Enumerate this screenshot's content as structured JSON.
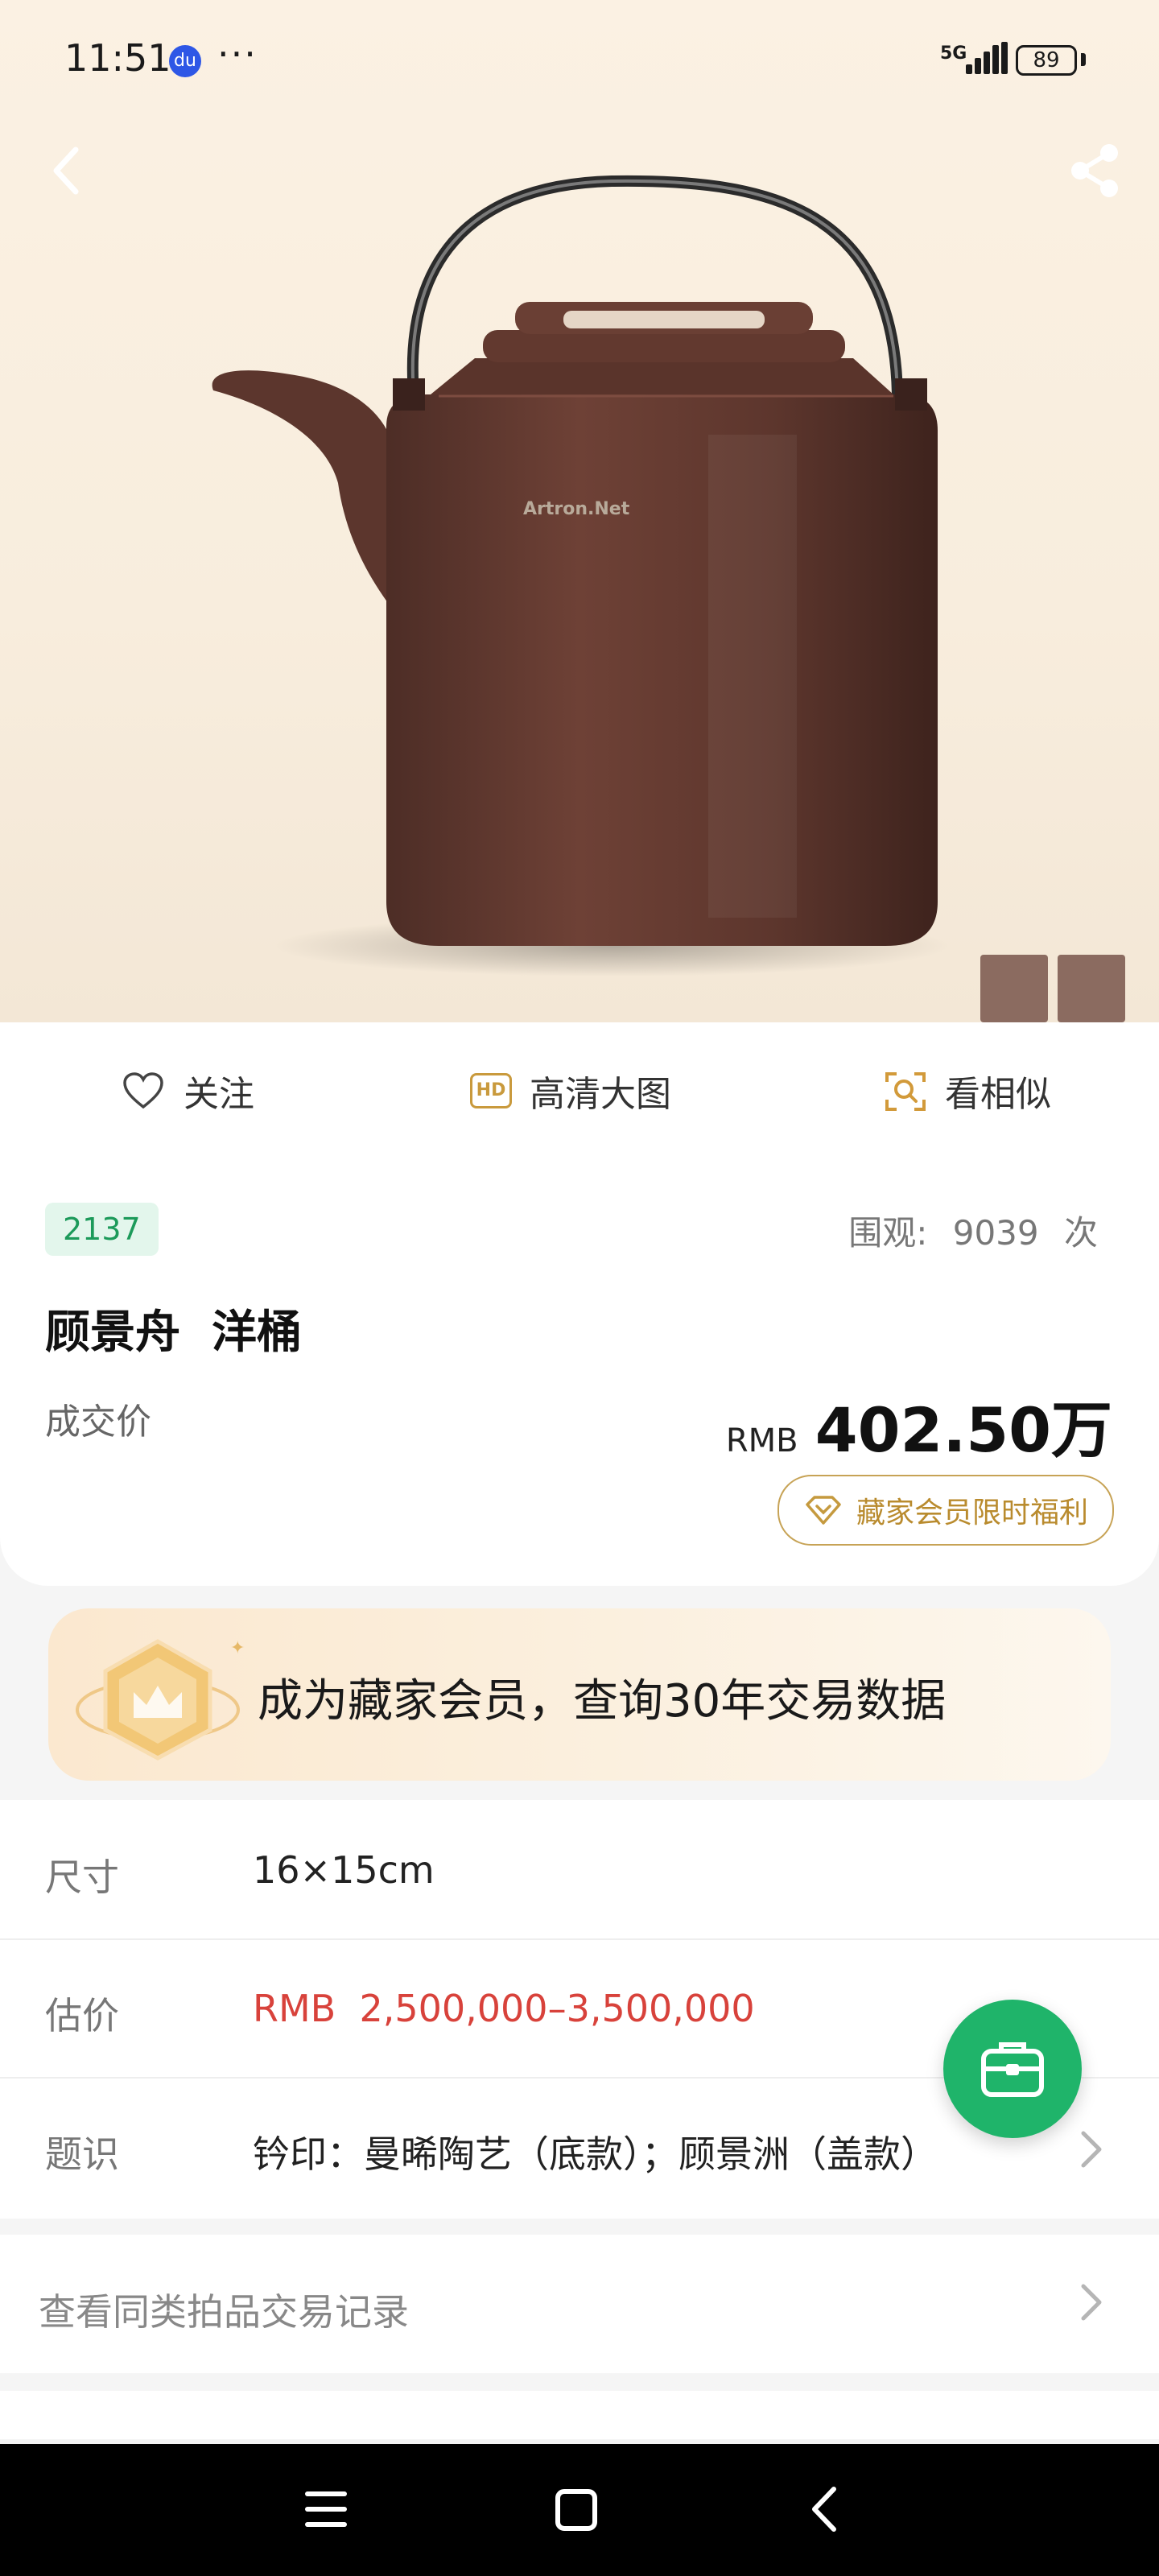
{
  "status_bar": {
    "time": "11:51",
    "app_icon_text": "du",
    "more": "···",
    "network": "5G",
    "battery": "89"
  },
  "hero": {
    "watermark": "Artron.Net"
  },
  "actions": {
    "follow": "关注",
    "hd_badge": "HD",
    "hd_label": "高清大图",
    "similar": "看相似"
  },
  "lot": {
    "number": "2137",
    "views_label": "围观:",
    "views_count": "9039",
    "views_unit": "次",
    "title": "顾景舟  洋桶",
    "deal_label": "成交价",
    "currency": "RMB",
    "price": "402.50万",
    "member_benefit": "藏家会员限时福利"
  },
  "banner": {
    "text": "成为藏家会员，查询30年交易数据"
  },
  "details": [
    {
      "key": "尺寸",
      "value": "16×15cm"
    },
    {
      "key": "估价",
      "value": "RMB  2,500,000–3,500,000"
    },
    {
      "key": "题识",
      "value": "钤印：曼晞陶艺（底款）；顾景洲（盖款）"
    }
  ],
  "records_link": "查看同类拍品交易记录",
  "colors": {
    "accent_green": "#1fb46a",
    "estimate_red": "#d8423b",
    "gold": "#c7a356"
  }
}
